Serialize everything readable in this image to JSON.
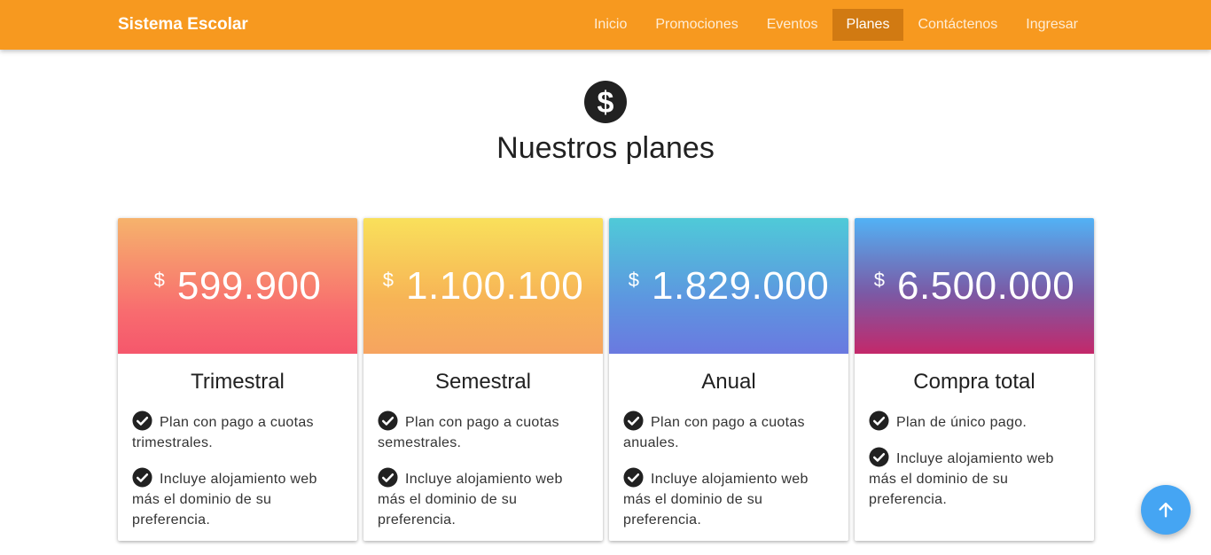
{
  "navbar": {
    "brand": "Sistema Escolar",
    "links": [
      {
        "label": "Inicio"
      },
      {
        "label": "Promociones"
      },
      {
        "label": "Eventos"
      },
      {
        "label": "Planes",
        "active": true
      },
      {
        "label": "Contáctenos"
      },
      {
        "label": "Ingresar"
      }
    ]
  },
  "hero": {
    "icon": "dollar-circle-icon",
    "title": "Nuestros planes"
  },
  "plans": [
    {
      "currency": "$",
      "price": "599.900",
      "name": "Trimestral",
      "features": [
        "Plan con pago a cuotas trimestrales.",
        "Incluye alojamiento web más el dominio de su preferencia."
      ]
    },
    {
      "currency": "$",
      "price": "1.100.100",
      "name": "Semestral",
      "features": [
        "Plan con pago a cuotas semestrales.",
        "Incluye alojamiento web más el dominio de su preferencia."
      ]
    },
    {
      "currency": "$",
      "price": "1.829.000",
      "name": "Anual",
      "features": [
        "Plan con pago a cuotas anuales.",
        "Incluye alojamiento web más el dominio de su preferencia."
      ]
    },
    {
      "currency": "$",
      "price": "6.500.000",
      "name": "Compra total",
      "features": [
        "Plan de único pago.",
        "Incluye alojamiento web más el dominio de su preferencia."
      ]
    }
  ],
  "colors": {
    "navbar": "#f7991f",
    "nav_active": "#d17a12",
    "fab": "#45a5f3"
  },
  "fab": {
    "icon": "arrow-up-icon"
  }
}
